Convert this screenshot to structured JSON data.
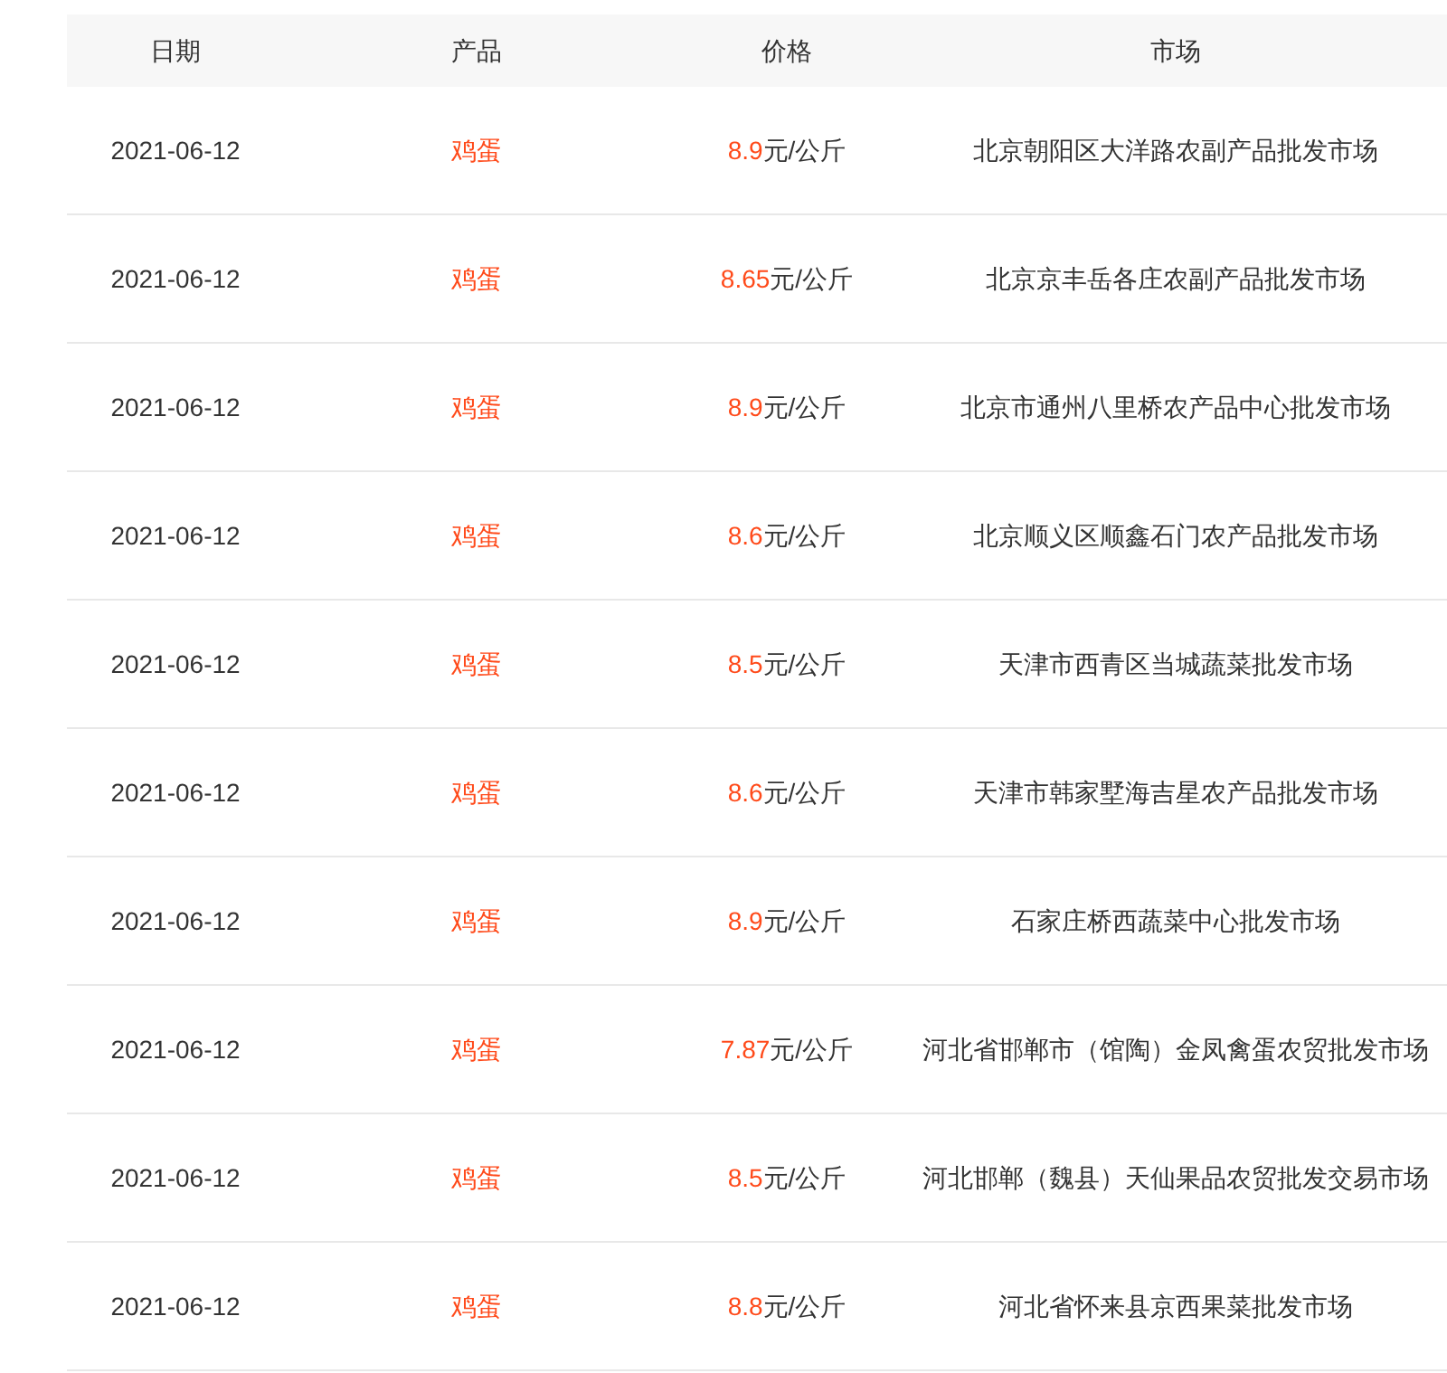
{
  "table": {
    "columns": [
      "日期",
      "产品",
      "价格",
      "市场"
    ],
    "rows": [
      {
        "date": "2021-06-12",
        "product": "鸡蛋",
        "price": "8.9",
        "unit": "元/公斤",
        "market": "北京朝阳区大洋路农副产品批发市场"
      },
      {
        "date": "2021-06-12",
        "product": "鸡蛋",
        "price": "8.65",
        "unit": "元/公斤",
        "market": "北京京丰岳各庄农副产品批发市场"
      },
      {
        "date": "2021-06-12",
        "product": "鸡蛋",
        "price": "8.9",
        "unit": "元/公斤",
        "market": "北京市通州八里桥农产品中心批发市场"
      },
      {
        "date": "2021-06-12",
        "product": "鸡蛋",
        "price": "8.6",
        "unit": "元/公斤",
        "market": "北京顺义区顺鑫石门农产品批发市场"
      },
      {
        "date": "2021-06-12",
        "product": "鸡蛋",
        "price": "8.5",
        "unit": "元/公斤",
        "market": "天津市西青区当城蔬菜批发市场"
      },
      {
        "date": "2021-06-12",
        "product": "鸡蛋",
        "price": "8.6",
        "unit": "元/公斤",
        "market": "天津市韩家墅海吉星农产品批发市场"
      },
      {
        "date": "2021-06-12",
        "product": "鸡蛋",
        "price": "8.9",
        "unit": "元/公斤",
        "market": "石家庄桥西蔬菜中心批发市场"
      },
      {
        "date": "2021-06-12",
        "product": "鸡蛋",
        "price": "7.87",
        "unit": "元/公斤",
        "market": "河北省邯郸市（馆陶）金凤禽蛋农贸批发市场"
      },
      {
        "date": "2021-06-12",
        "product": "鸡蛋",
        "price": "8.5",
        "unit": "元/公斤",
        "market": "河北邯郸（魏县）天仙果品农贸批发交易市场"
      },
      {
        "date": "2021-06-12",
        "product": "鸡蛋",
        "price": "8.8",
        "unit": "元/公斤",
        "market": "河北省怀来县京西果菜批发市场"
      }
    ]
  }
}
